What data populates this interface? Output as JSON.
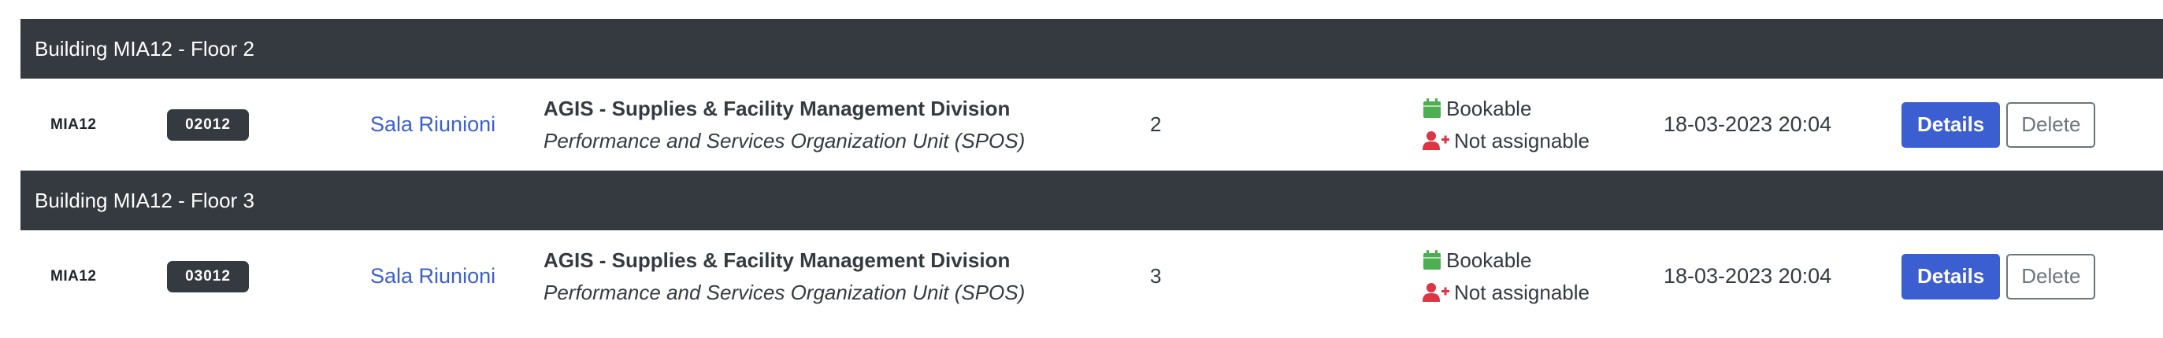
{
  "colors": {
    "header_bg": "#343a40",
    "link": "#3b5fd1",
    "bookable_icon": "#4caf50",
    "not_assignable_icon": "#dc3545",
    "details_button": "#3b5fd1"
  },
  "groups": [
    {
      "header": "Building MIA12 - Floor 2",
      "rooms": [
        {
          "building": "MIA12",
          "room_code": "02012",
          "room_name": "Sala Riunioni",
          "org_title": "AGIS - Supplies & Facility Management Division",
          "org_unit": "Performance and Services Organization Unit (SPOS)",
          "capacity": "2",
          "status_booking": "Bookable",
          "status_booking_icon": "calendar-icon",
          "status_assign": "Not assignable",
          "status_assign_icon": "user-plus-icon",
          "timestamp": "18-03-2023 20:04",
          "details_label": "Details",
          "delete_label": "Delete"
        }
      ]
    },
    {
      "header": "Building MIA12 - Floor 3",
      "rooms": [
        {
          "building": "MIA12",
          "room_code": "03012",
          "room_name": "Sala Riunioni",
          "org_title": "AGIS - Supplies & Facility Management Division",
          "org_unit": "Performance and Services Organization Unit (SPOS)",
          "capacity": "3",
          "status_booking": "Bookable",
          "status_booking_icon": "calendar-icon",
          "status_assign": "Not assignable",
          "status_assign_icon": "user-plus-icon",
          "timestamp": "18-03-2023 20:04",
          "details_label": "Details",
          "delete_label": "Delete"
        }
      ]
    }
  ]
}
